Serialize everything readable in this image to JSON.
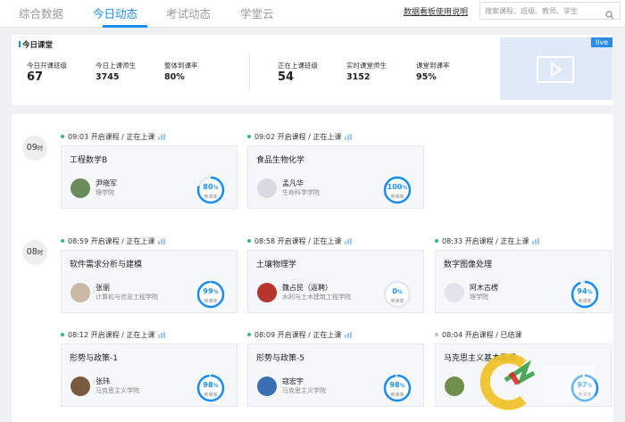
{
  "tabs": [
    {
      "label": "综合数据"
    },
    {
      "label": "今日动态"
    },
    {
      "label": "考试动态"
    },
    {
      "label": "学堂云"
    }
  ],
  "help_link": "数据看板使用说明",
  "search": {
    "placeholder": "搜索课程、班级、教师、学生"
  },
  "summary": {
    "title": "今日课堂",
    "stats": [
      {
        "label": "今日开课班级",
        "value": "67"
      },
      {
        "label": "今日上课师生",
        "value": "3745"
      },
      {
        "label": "整体到课率",
        "value": "80%"
      },
      {
        "label": "正在上课班级",
        "value": "54"
      },
      {
        "label": "实时课堂师生",
        "value": "3152"
      },
      {
        "label": "课堂到课率",
        "value": "95%"
      }
    ],
    "live_label": "live"
  },
  "hours": [
    {
      "num": "09",
      "unit": "时"
    },
    {
      "num": "08",
      "unit": "时"
    }
  ],
  "attendance_label": "到课率",
  "colors": {
    "accent": "#1a8df0",
    "live_dot": "#2fbf71",
    "card_bg": "#f6f7f9"
  },
  "classes": [
    {
      "status": "09:03 开启课程 / 正在上课",
      "title": "工程数学B",
      "teacher": "尹晓军",
      "college": "理学院",
      "pct": "80",
      "suffix": "%",
      "rate": 0.8,
      "live": true
    },
    {
      "status": "09:02 开启课程 / 正在上课",
      "title": "食品生物化学",
      "teacher": "孟凡华",
      "college": "生命科学学院",
      "pct": "100",
      "suffix": "%",
      "rate": 1.0,
      "live": true
    },
    {
      "status": "08:59 开启课程 / 正在上课",
      "title": "软件需求分析与建模",
      "teacher": "张丽",
      "college": "计算机与信息工程学院",
      "pct": "99",
      "suffix": "%",
      "rate": 0.99,
      "live": true
    },
    {
      "status": "08:58 开启课程 / 正在上课",
      "title": "土壤物理学",
      "teacher": "魏占民（返聘）",
      "college": "水利与土木建筑工程学院",
      "pct": "0",
      "suffix": "%",
      "rate": 0.0,
      "live": true
    },
    {
      "status": "08:33 开启课程 / 正在上课",
      "title": "数字图像处理",
      "teacher": "阿木古楞",
      "college": "理学院",
      "pct": "94",
      "suffix": "%",
      "rate": 0.94,
      "live": true
    },
    {
      "status": "08:12 开启课程 / 正在上课",
      "title": "形势与政策-1",
      "teacher": "张玮",
      "college": "马克思主义学院",
      "pct": "98",
      "suffix": "%",
      "rate": 0.98,
      "live": true
    },
    {
      "status": "08:09 开启课程 / 正在上课",
      "title": "形势与政策-5",
      "teacher": "寇宏宇",
      "college": "马克思主义学院",
      "pct": "98",
      "suffix": "%",
      "rate": 0.98,
      "live": true
    },
    {
      "status": "08:04 开启课程 / 已结课",
      "title": "马克思主义基本原理",
      "teacher": "",
      "college": "",
      "pct": "97",
      "suffix": "%",
      "rate": 0.97,
      "live": false
    }
  ]
}
